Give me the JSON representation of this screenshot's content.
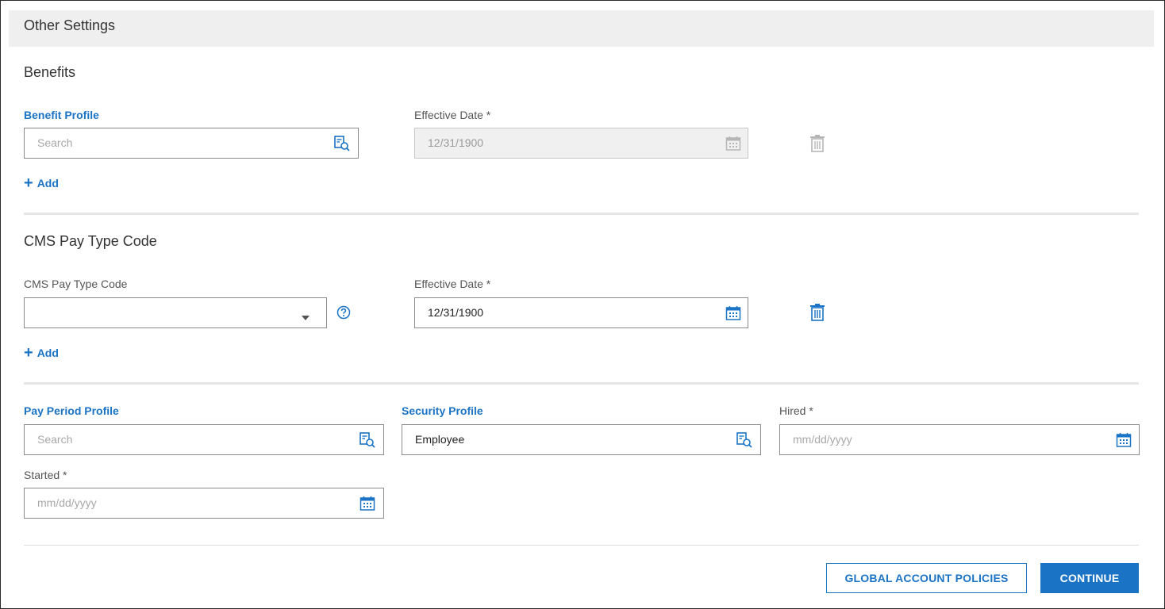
{
  "panel": {
    "title": "Other Settings"
  },
  "benefits": {
    "section_title": "Benefits",
    "profile_label": "Benefit Profile",
    "profile_placeholder": "Search",
    "effective_label": "Effective Date *",
    "effective_value": "12/31/1900",
    "add_label": "Add"
  },
  "cms": {
    "section_title": "CMS Pay Type Code",
    "code_label": "CMS Pay Type Code",
    "code_value": "",
    "effective_label": "Effective Date *",
    "effective_value": "12/31/1900",
    "add_label": "Add"
  },
  "profiles": {
    "pay_period_label": "Pay Period Profile",
    "pay_period_placeholder": "Search",
    "security_label": "Security Profile",
    "security_value": "Employee",
    "hired_label": "Hired *",
    "hired_placeholder": "mm/dd/yyyy",
    "started_label": "Started *",
    "started_placeholder": "mm/dd/yyyy"
  },
  "actions": {
    "global_policies_label": "GLOBAL ACCOUNT POLICIES",
    "continue_label": "CONTINUE"
  },
  "colors": {
    "accent": "#1a73c4",
    "header_bg": "#efefef",
    "disabled_icon": "#b5b5b5"
  }
}
